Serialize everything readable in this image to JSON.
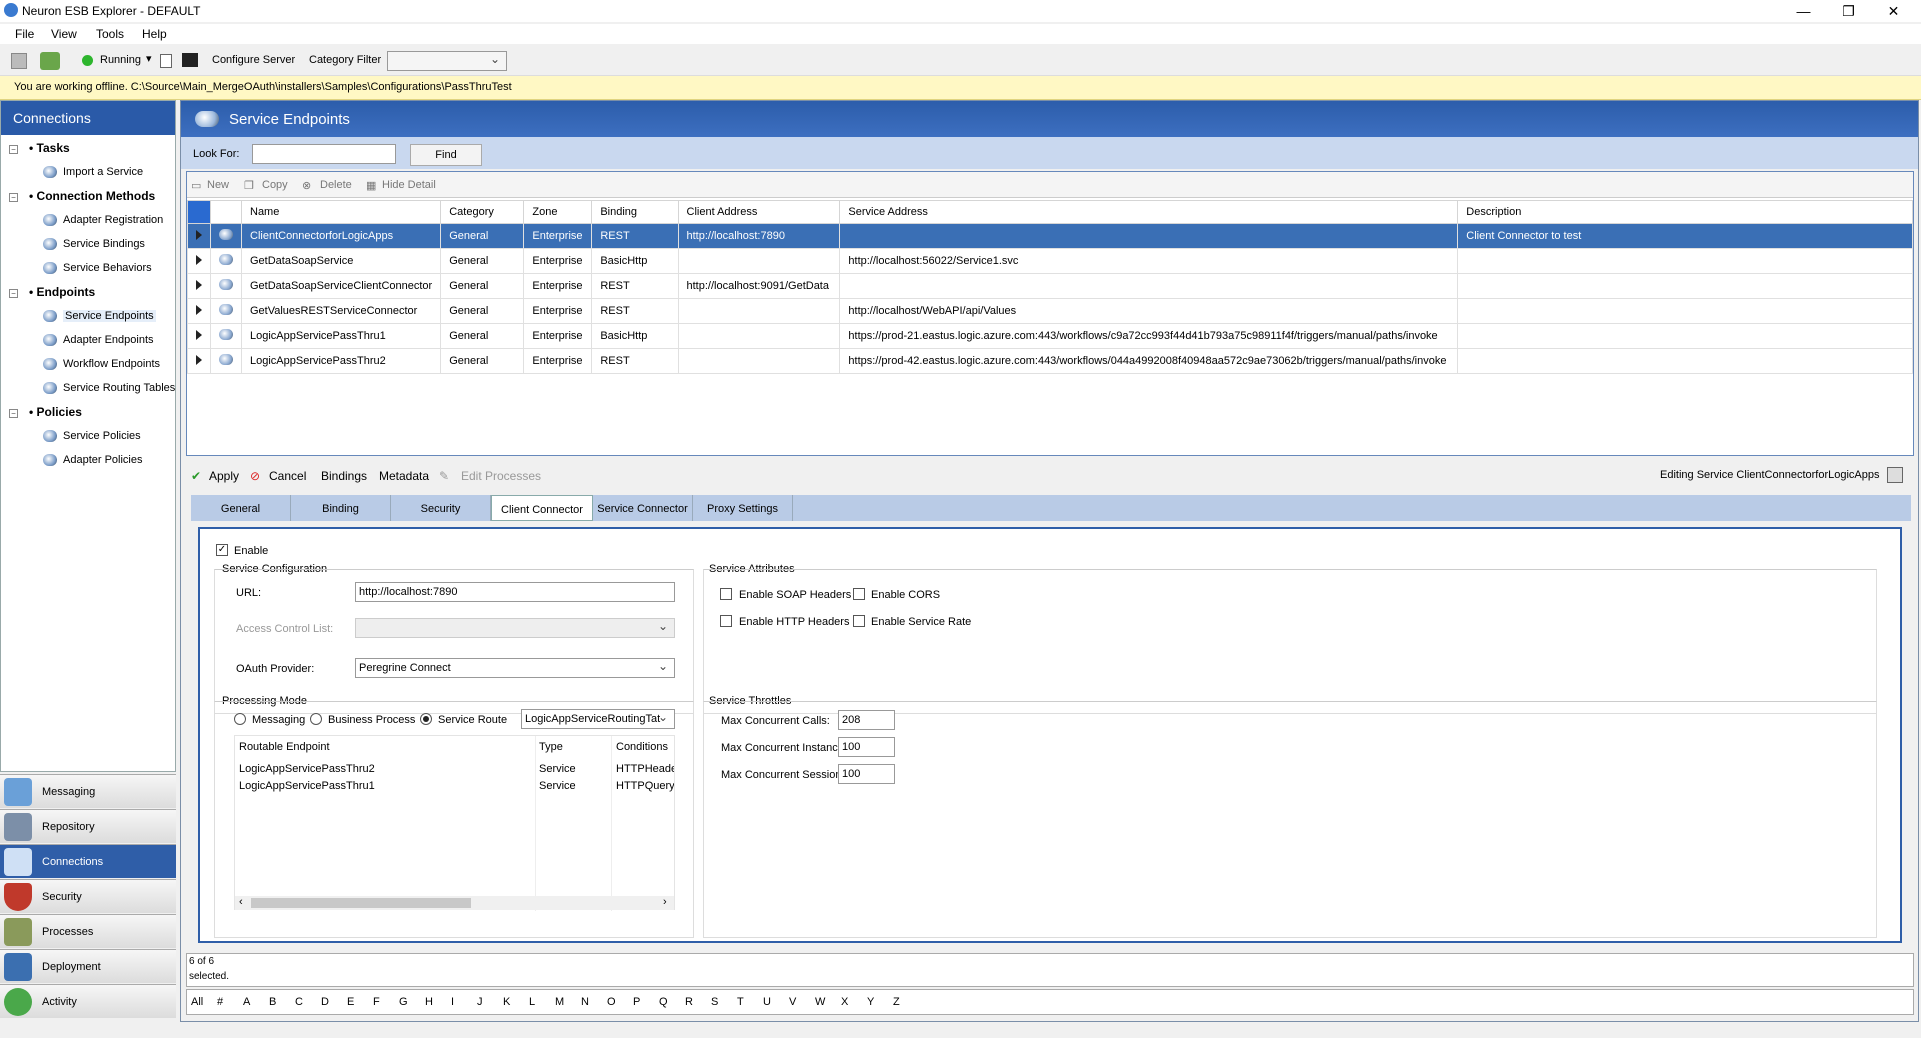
{
  "app": {
    "title": "Neuron ESB Explorer - DEFAULT"
  },
  "menu": [
    "File",
    "View",
    "Tools",
    "Help"
  ],
  "toolbar": {
    "status": "Running",
    "configure_server": "Configure Server",
    "category_filter_label": "Category Filter",
    "category_filter_value": ""
  },
  "offline_banner": "You are working offline. C:\\Source\\Main_MergeOAuth\\installers\\Samples\\Configurations\\PassThruTest",
  "sidebar": {
    "header": "Connections",
    "sections": [
      {
        "title": "Tasks",
        "items": [
          "Import a Service"
        ]
      },
      {
        "title": "Connection Methods",
        "items": [
          "Adapter Registration",
          "Service Bindings",
          "Service Behaviors"
        ]
      },
      {
        "title": "Endpoints",
        "items": [
          "Service Endpoints",
          "Adapter Endpoints",
          "Workflow Endpoints",
          "Service Routing Tables"
        ]
      },
      {
        "title": "Policies",
        "items": [
          "Service Policies",
          "Adapter Policies"
        ]
      }
    ],
    "nav": [
      "Messaging",
      "Repository",
      "Connections",
      "Security",
      "Processes",
      "Deployment",
      "Activity"
    ],
    "active_nav": "Connections"
  },
  "main": {
    "title": "Service Endpoints",
    "look_for_label": "Look For:",
    "look_for_value": "",
    "find_label": "Find",
    "grid_tools": [
      "New",
      "Copy",
      "Delete",
      "Hide Detail"
    ],
    "columns": [
      "Name",
      "Category",
      "Zone",
      "Binding",
      "Client Address",
      "Service Address",
      "Description"
    ],
    "rows": [
      [
        "ClientConnectorforLogicApps",
        "General",
        "Enterprise",
        "REST",
        "http://localhost:7890",
        "",
        "Client Connector to test"
      ],
      [
        "GetDataSoapService",
        "General",
        "Enterprise",
        "BasicHttp",
        "",
        "http://localhost:56022/Service1.svc",
        ""
      ],
      [
        "GetDataSoapServiceClientConnector",
        "General",
        "Enterprise",
        "REST",
        "http://localhost:9091/GetData",
        "",
        ""
      ],
      [
        "GetValuesRESTServiceConnector",
        "General",
        "Enterprise",
        "REST",
        "",
        "http://localhost/WebAPI/api/Values",
        ""
      ],
      [
        "LogicAppServicePassThru1",
        "General",
        "Enterprise",
        "BasicHttp",
        "",
        "https://prod-21.eastus.logic.azure.com:443/workflows/c9a72cc993f44d41b793a75c98911f4f/triggers/manual/paths/invoke",
        ""
      ],
      [
        "LogicAppServicePassThru2",
        "General",
        "Enterprise",
        "REST",
        "",
        "https://prod-42.eastus.logic.azure.com:443/workflows/044a4992008f40948aa572c9ae73062b/triggers/manual/paths/invoke",
        ""
      ]
    ]
  },
  "edit": {
    "apply": "Apply",
    "cancel": "Cancel",
    "bindings": "Bindings",
    "metadata": "Metadata",
    "edit_processes": "Edit Processes",
    "editing_label": "Editing Service ClientConnectorforLogicApps",
    "tabs": [
      "General",
      "Binding",
      "Security",
      "Client Connector",
      "Service Connector",
      "Proxy Settings"
    ],
    "active_tab": "Client Connector"
  },
  "client_connector": {
    "enable_label": "Enable",
    "service_config_label": "Service Configuration",
    "url_label": "URL:",
    "url_value": "http://localhost:7890",
    "acl_label": "Access Control List:",
    "oauth_label": "OAuth Provider:",
    "oauth_value": "Peregrine Connect",
    "service_attributes_label": "Service Attributes",
    "attr_soap": "Enable SOAP Headers",
    "attr_cors": "Enable CORS",
    "attr_http": "Enable HTTP Headers",
    "attr_rate": "Enable Service Rate",
    "processing_mode_label": "Processing Mode",
    "mode_messaging": "Messaging",
    "mode_business": "Business Process",
    "mode_route": "Service Route",
    "route_table_value": "LogicAppServiceRoutingTat",
    "route_columns": [
      "Routable Endpoint",
      "Type",
      "Conditions"
    ],
    "route_rows": [
      [
        "LogicAppServicePassThru2",
        "Service",
        "HTTPHeader"
      ],
      [
        "LogicAppServicePassThru1",
        "Service",
        "HTTPQuery:s"
      ]
    ],
    "throttles_label": "Service Throttles",
    "max_calls_label": "Max Concurrent Calls:",
    "max_calls": "208",
    "max_instances_label": "Max Concurrent Instances:",
    "max_instances": "100",
    "max_sessions_label": "Max Concurrent Sessions:",
    "max_sessions": "100"
  },
  "status": {
    "line1": "6 of 6",
    "line2": "selected."
  },
  "alpha": [
    "All",
    "#",
    "A",
    "B",
    "C",
    "D",
    "E",
    "F",
    "G",
    "H",
    "I",
    "J",
    "K",
    "L",
    "M",
    "N",
    "O",
    "P",
    "Q",
    "R",
    "S",
    "T",
    "U",
    "V",
    "W",
    "X",
    "Y",
    "Z"
  ],
  "colors": {
    "accent": "#2f5ea8",
    "selection": "#3a6fb5",
    "banner": "#fff8c4"
  }
}
